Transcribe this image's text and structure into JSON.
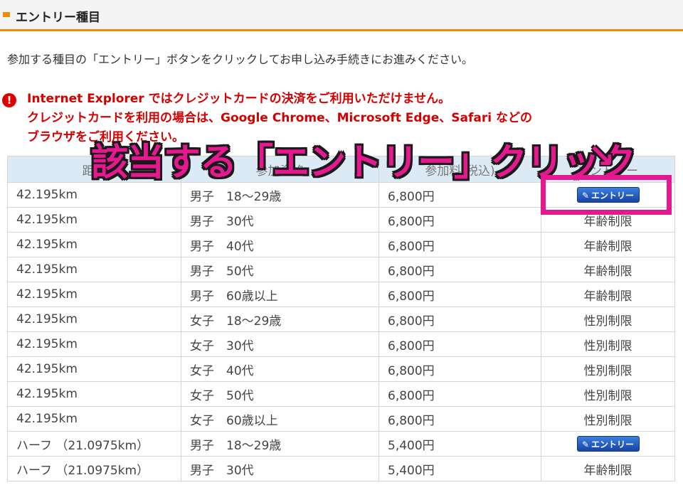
{
  "header": {
    "title": "エントリー種目"
  },
  "intro_text": "参加する種目の「エントリー」ボタンをクリックしてお申し込み手続きにお進みください。",
  "warning": {
    "icon": "exclamation-icon",
    "lines": [
      "Internet Explorer ではクレジットカードの決済をご利用いただけません。",
      "クレジットカードを利用の場合は、Google Chrome、Microsoft Edge、Safari などの",
      "ブラウザをご利用ください。"
    ]
  },
  "overlay": {
    "text": "該当する「エントリー」クリック",
    "arrow": "↘"
  },
  "table": {
    "columns": [
      "距離",
      "参加資格",
      "参加料(税込)",
      "エントリー"
    ],
    "entry_button_label": "エントリー",
    "rows": [
      {
        "distance": "42.195km",
        "eligibility": "男子　18～29歳",
        "fee": "6,800円",
        "entry": "エントリー",
        "is_button": true
      },
      {
        "distance": "42.195km",
        "eligibility": "男子　30代",
        "fee": "6,800円",
        "entry": "年齢制限",
        "is_button": false
      },
      {
        "distance": "42.195km",
        "eligibility": "男子　40代",
        "fee": "6,800円",
        "entry": "年齢制限",
        "is_button": false
      },
      {
        "distance": "42.195km",
        "eligibility": "男子　50代",
        "fee": "6,800円",
        "entry": "年齢制限",
        "is_button": false
      },
      {
        "distance": "42.195km",
        "eligibility": "男子　60歳以上",
        "fee": "6,800円",
        "entry": "年齢制限",
        "is_button": false
      },
      {
        "distance": "42.195km",
        "eligibility": "女子　18～29歳",
        "fee": "6,800円",
        "entry": "性別制限",
        "is_button": false
      },
      {
        "distance": "42.195km",
        "eligibility": "女子　30代",
        "fee": "6,800円",
        "entry": "性別制限",
        "is_button": false
      },
      {
        "distance": "42.195km",
        "eligibility": "女子　40代",
        "fee": "6,800円",
        "entry": "性別制限",
        "is_button": false
      },
      {
        "distance": "42.195km",
        "eligibility": "女子　50代",
        "fee": "6,800円",
        "entry": "性別制限",
        "is_button": false
      },
      {
        "distance": "42.195km",
        "eligibility": "女子　60歳以上",
        "fee": "6,800円",
        "entry": "性別制限",
        "is_button": false
      },
      {
        "distance": "ハーフ （21.0975km）",
        "eligibility": "男子　18～29歳",
        "fee": "5,400円",
        "entry": "エントリー",
        "is_button": true
      },
      {
        "distance": "ハーフ （21.0975km）",
        "eligibility": "男子　30代",
        "fee": "5,400円",
        "entry": "年齢制限",
        "is_button": false
      }
    ]
  },
  "colors": {
    "accent": "#f08c00",
    "warning": "#d40000",
    "annotation": "#e6188f",
    "header_bg": "#dceaf5",
    "button": "#1f55c0"
  }
}
